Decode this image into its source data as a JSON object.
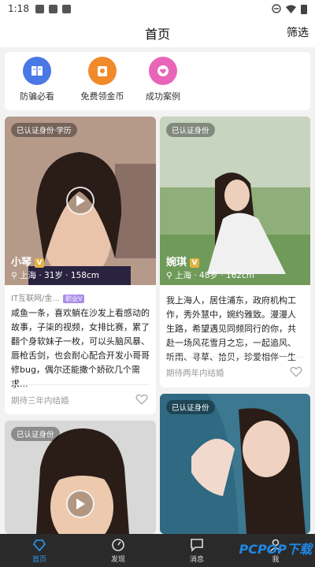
{
  "status": {
    "time": "1:18"
  },
  "header": {
    "title": "首页",
    "filter_label": "筛选"
  },
  "quick_links": [
    {
      "label": "防骗必看",
      "icon": "book-icon",
      "color": "#4a78e6"
    },
    {
      "label": "免费领金币",
      "icon": "coin-bag-icon",
      "color": "#f08a2a"
    },
    {
      "label": "成功案例",
      "icon": "heart-bubble-icon",
      "color": "#e865b7"
    }
  ],
  "cards": [
    {
      "badge": "已认证身份·学历",
      "name": "小琴",
      "meta": "上海 · 31岁 · 158cm",
      "job": "IT互联网/金...",
      "job_tag": "职业V",
      "desc": "咸鱼一条，喜欢躺在沙发上看感动的故事，子柒的视频，女排比赛，累了翻个身软妹子一枚，可以头脑风暴、唇枪舌剑，也会耐心配合开发小哥哥修bug，偶尔还能撒个娇砍几个需求...",
      "expect": "期待三年内结婚"
    },
    {
      "badge": "已认证身份",
      "name": "婉琪",
      "meta": "上海 · 48岁 · 162cm",
      "desc": "我上海人，居住浦东，政府机构工作，秀外慧中，婉约雅致。漫漫人生路，希望遇见同频同行的你，共赴一场风花雪月之忘，一起追风、听雨、寻草、拾贝，珍爱相伴一生",
      "expect": "期待两年内结婚"
    },
    {
      "badge": "已认证身份"
    },
    {
      "badge": "已认证身份"
    }
  ],
  "tabs": [
    {
      "label": "首页",
      "icon": "heart-diamond-icon"
    },
    {
      "label": "发现",
      "icon": "compass-icon"
    },
    {
      "label": "消息",
      "icon": "chat-icon"
    },
    {
      "label": "我",
      "icon": "person-icon"
    }
  ],
  "watermark": "PCPOP下载",
  "colors": {
    "accent": "#2b9bf4",
    "tabbar": "#2a2a2a",
    "verified": "#e3b341"
  }
}
